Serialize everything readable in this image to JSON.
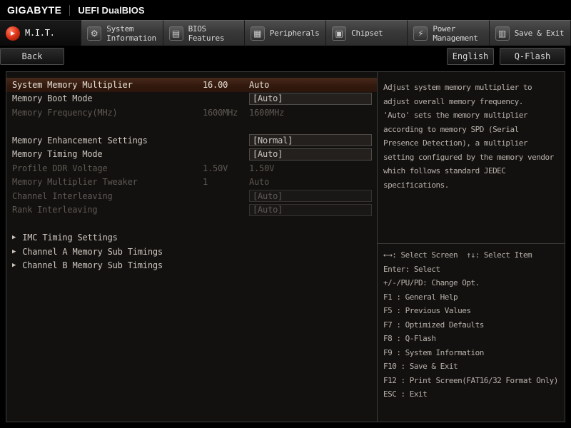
{
  "header": {
    "brand": "GIGABYTE",
    "title": "UEFI DualBIOS"
  },
  "tabs": [
    {
      "label": "M.I.T.",
      "icon": "mit-icon",
      "active": true
    },
    {
      "label": "System Information",
      "icon": "system-information-icon",
      "active": false
    },
    {
      "label": "BIOS Features",
      "icon": "bios-features-icon",
      "active": false
    },
    {
      "label": "Peripherals",
      "icon": "peripherals-icon",
      "active": false
    },
    {
      "label": "Chipset",
      "icon": "chipset-icon",
      "active": false
    },
    {
      "label": "Power Management",
      "icon": "power-management-icon",
      "active": false
    },
    {
      "label": "Save & Exit",
      "icon": "save-exit-icon",
      "active": false
    }
  ],
  "toolbar": {
    "back": "Back",
    "language": "English",
    "qflash": "Q-Flash"
  },
  "settings": [
    {
      "label": "System Memory Multiplier",
      "mid": "16.00",
      "value": "Auto",
      "highlighted": true,
      "boxed": false,
      "enabled": true
    },
    {
      "label": "Memory Boot Mode",
      "mid": "",
      "value": "[Auto]",
      "boxed": true,
      "enabled": true
    },
    {
      "label": "Memory Frequency(MHz)",
      "mid": "1600MHz",
      "value": "1600MHz",
      "boxed": false,
      "enabled": false
    },
    {
      "spacer": true
    },
    {
      "label": "Memory Enhancement Settings",
      "mid": "",
      "value": "[Normal]",
      "boxed": true,
      "enabled": true
    },
    {
      "label": "Memory Timing Mode",
      "mid": "",
      "value": "[Auto]",
      "boxed": true,
      "enabled": true
    },
    {
      "label": "Profile DDR Voltage",
      "mid": "1.50V",
      "value": "1.50V",
      "boxed": false,
      "enabled": false
    },
    {
      "label": "Memory Multiplier Tweaker",
      "mid": "1",
      "value": "Auto",
      "boxed": false,
      "enabled": false
    },
    {
      "label": "Channel Interleaving",
      "mid": "",
      "value": "[Auto]",
      "boxed": true,
      "enabled": false
    },
    {
      "label": "Rank Interleaving",
      "mid": "",
      "value": "[Auto]",
      "boxed": true,
      "enabled": false
    },
    {
      "spacer": true
    }
  ],
  "submenus": [
    "IMC Timing Settings",
    "Channel A Memory Sub Timings",
    "Channel B Memory Sub Timings"
  ],
  "help": {
    "description": "Adjust system memory multiplier to\nadjust overall memory frequency.\n'Auto' sets the memory multiplier\naccording to memory SPD (Serial\nPresence Detection), a multiplier\nsetting configured by the memory vendor\nwhich follows standard JEDEC\nspecifications.",
    "keys": [
      "←→: Select Screen  ↑↓: Select Item",
      "Enter: Select",
      "+/-/PU/PD: Change Opt.",
      "F1 : General Help",
      "F5 : Previous Values",
      "F7 : Optimized Defaults",
      "F8 : Q-Flash",
      "F9 : System Information",
      "F10 : Save & Exit",
      "F12 : Print Screen(FAT16/32 Format Only)",
      "ESC : Exit"
    ]
  }
}
